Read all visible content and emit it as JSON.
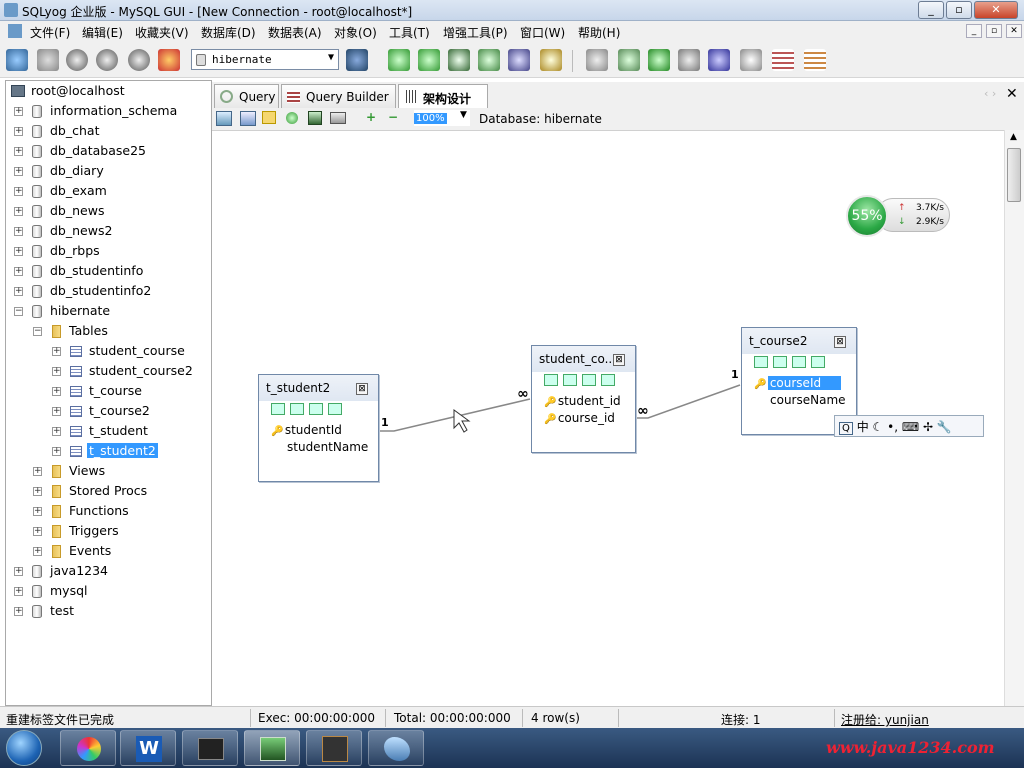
{
  "window": {
    "title": "SQLyog 企业版 - MySQL GUI - [New Connection - root@localhost*]"
  },
  "menu": [
    "文件(F)",
    "编辑(E)",
    "收藏夹(V)",
    "数据库(D)",
    "数据表(A)",
    "对象(O)",
    "工具(T)",
    "增强工具(P)",
    "窗口(W)",
    "帮助(H)"
  ],
  "toolbar": {
    "db_select": "hibernate"
  },
  "tree": {
    "root": "root@localhost",
    "databases": [
      "information_schema",
      "db_chat",
      "db_database25",
      "db_diary",
      "db_exam",
      "db_news",
      "db_news2",
      "db_rbps",
      "db_studentinfo",
      "db_studentinfo2",
      "hibernate"
    ],
    "hibernate_folders": {
      "tables_label": "Tables",
      "tables": [
        "student_course",
        "student_course2",
        "t_course",
        "t_course2",
        "t_student",
        "t_student2"
      ],
      "others": [
        "Views",
        "Stored Procs",
        "Functions",
        "Triggers",
        "Events"
      ]
    },
    "after": [
      "java1234",
      "mysql",
      "test"
    ]
  },
  "tabs": [
    "Query",
    "Query Builder",
    "架构设计器"
  ],
  "designer": {
    "zoom": "100%",
    "database_label": "Database: hibernate"
  },
  "netmon": {
    "percent": "55%",
    "up": "3.7K/s",
    "down": "2.9K/s"
  },
  "boxes": {
    "t_student2": {
      "title": "t_student2",
      "fields": [
        "studentId",
        "studentName"
      ]
    },
    "student_course": {
      "title": "student_co...",
      "fields": [
        "student_id",
        "course_id"
      ]
    },
    "t_course2": {
      "title": "t_course2",
      "fields": [
        "courseId",
        "courseName"
      ]
    }
  },
  "relations": {
    "one": "1",
    "many": "∞"
  },
  "ime": {
    "label": "中"
  },
  "status": {
    "msg": "重建标签文件已完成",
    "exec": "Exec: 00:00:00:000",
    "total": "Total: 00:00:00:000",
    "rows": "4 row(s)",
    "conn": "连接: 1",
    "reg": "注册给: yunjian"
  },
  "taskbar": {
    "watermark": "www.java1234.com"
  }
}
